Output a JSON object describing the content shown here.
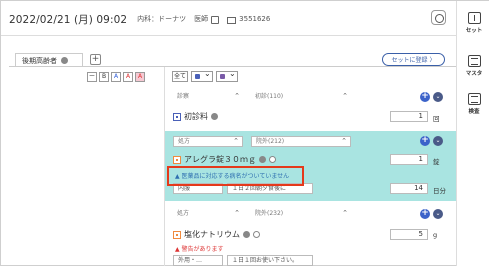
{
  "header": {
    "datetime": "2022/02/21 (月) 09:02",
    "department": "内科：ドーナツ",
    "doctor": "医師",
    "patient_id": "3551626"
  },
  "sidebar": {
    "items": [
      {
        "label": "セット",
        "icon": "set-icon"
      },
      {
        "label": "マスタ",
        "icon": "master-icon"
      },
      {
        "label": "検査",
        "icon": "exam-icon"
      }
    ]
  },
  "tabs": {
    "active_label": "後期高齢者",
    "add_label": "+",
    "set_register_label": "セットに登録 〉"
  },
  "toolbar": {
    "buttons": [
      "ー",
      "B",
      "A",
      "A",
      "A"
    ]
  },
  "filter": {
    "all_label": "全て"
  },
  "blocks": {
    "b1": {
      "category": "診察",
      "type": "初診(110)",
      "item": "初診料",
      "qty": "1",
      "unit": "回"
    },
    "b2": {
      "category": "処方",
      "type": "院外(212)",
      "item": "アレグラ錠３０ｍｇ",
      "qty": "1",
      "unit": "錠",
      "warning": "▲ 医薬品に対応する病名がついていません",
      "route": "内服",
      "usage": "１日２回朝夕食後に",
      "days": "14",
      "days_unit": "日分"
    },
    "b3": {
      "category": "処方",
      "type": "院外(232)",
      "item": "塩化ナトリウム",
      "qty": "5",
      "unit": "g",
      "error": "▲ 警告があります",
      "route": "外用・…",
      "usage": "１日１回お使い下さい。"
    }
  }
}
